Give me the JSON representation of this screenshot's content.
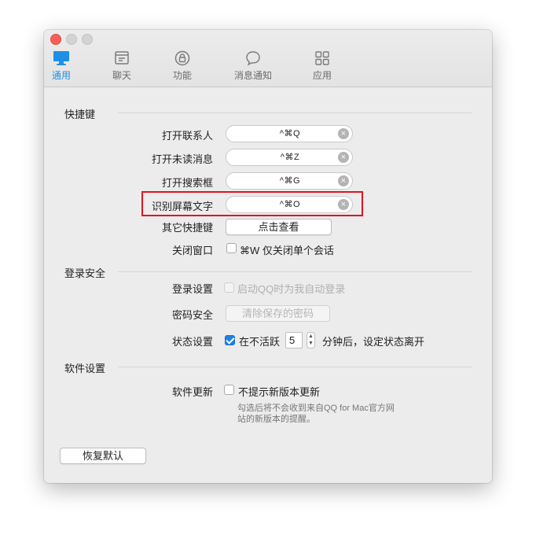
{
  "tabs": [
    {
      "label": "通用",
      "icon": "monitor-icon",
      "active": true
    },
    {
      "label": "聊天",
      "icon": "chat-window-icon",
      "active": false
    },
    {
      "label": "功能",
      "icon": "lock-icon",
      "active": false
    },
    {
      "label": "消息通知",
      "icon": "speech-bubble-icon",
      "active": false
    },
    {
      "label": "应用",
      "icon": "grid-icon",
      "active": false
    }
  ],
  "colors": {
    "accent": "#1e8fe6",
    "highlight": "#e0141c",
    "close": "#fc5f57"
  },
  "shortcuts": {
    "section_title": "快捷键",
    "items": [
      {
        "label": "打开联系人",
        "value": "^⌘Q"
      },
      {
        "label": "打开未读消息",
        "value": "^⌘Z"
      },
      {
        "label": "打开搜索框",
        "value": "^⌘G"
      },
      {
        "label": "识别屏幕文字",
        "value": "^⌘O"
      }
    ],
    "other_label": "其它快捷键",
    "other_button": "点击查看",
    "close_window_label": "关闭窗口",
    "close_window_option": "⌘W 仅关闭单个会话",
    "close_window_checked": false
  },
  "login": {
    "section_title": "登录安全",
    "login_settings_label": "登录设置",
    "auto_login_option": "启动QQ时为我自动登录",
    "auto_login_checked": false,
    "password_label": "密码安全",
    "clear_password_button": "清除保存的密码",
    "status_label": "状态设置",
    "inactive_prefix": "在不活跃",
    "inactive_minutes": "5",
    "inactive_suffix": "分钟后，设定状态离开",
    "inactive_checked": true
  },
  "software": {
    "section_title": "软件设置",
    "update_label": "软件更新",
    "no_update_option": "不提示新版本更新",
    "no_update_checked": false,
    "hint_line1": "勾选后将不会收到来自QQ for Mac官方网",
    "hint_line2": "站的新版本的提醒。"
  },
  "restore_button": "恢复默认"
}
